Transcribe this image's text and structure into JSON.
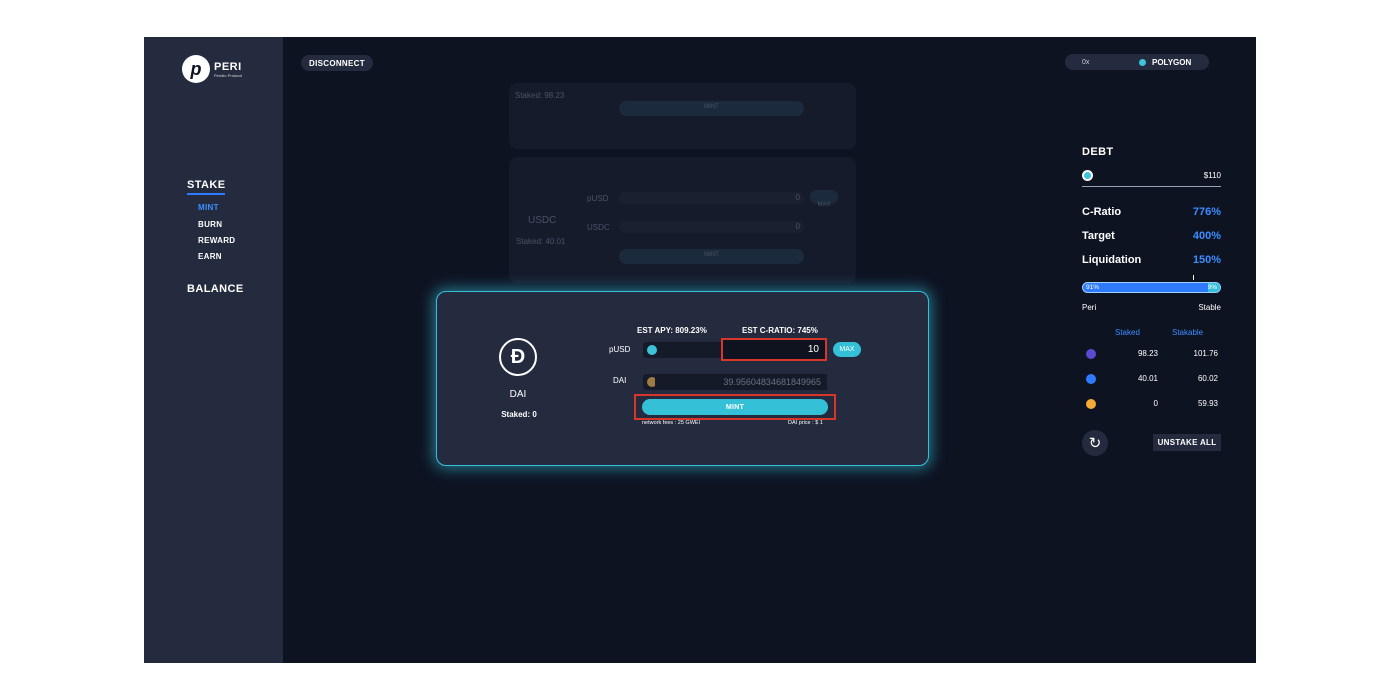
{
  "brand": {
    "name": "PERI",
    "tagline": "Peridio Protocol"
  },
  "header": {
    "disconnect": "DISCONNECT",
    "address": "0x",
    "network": "POLYGON"
  },
  "sidebar": {
    "stake": "STAKE",
    "items": [
      "MINT",
      "BURN",
      "REWARD",
      "EARN"
    ],
    "balance": "BALANCE"
  },
  "background_cards": {
    "top_staked": "Staked: 98.23",
    "top_mint": "MINT",
    "usdc_name": "USDC",
    "usdc_staked": "Staked: 40.01",
    "usdc_pusd_label": "pUSD",
    "usdc_pusd_value": "0",
    "usdc_max": "MAX",
    "usdc_usdc_label": "USDC",
    "usdc_usdc_value": "0",
    "usdc_mint": "MINT"
  },
  "modal": {
    "coin_name": "DAI",
    "staked": "Staked: 0",
    "est_apy": "EST APY: 809.23%",
    "est_cratio": "EST C-RATIO: 745%",
    "pusd_label": "pUSD",
    "pusd_amount": "10",
    "max": "MAX",
    "dai_label": "DAI",
    "dai_amount": "39.95604834681849965",
    "mint": "MINT",
    "fees": "network fees : 25 GWEI",
    "price": "DAI price : $ 1"
  },
  "debt_panel": {
    "title": "DEBT",
    "debt_value": "$110",
    "cratio_label": "C-Ratio",
    "cratio_value": "776%",
    "target_label": "Target",
    "target_value": "400%",
    "liq_label": "Liquidation",
    "liq_value": "150%",
    "peri_pct_label": "91%",
    "stable_pct_label": "9%",
    "peri_fraction": 0.91,
    "bar_left": "Peri",
    "bar_right": "Stable",
    "col_staked": "Staked",
    "col_stakable": "Stakable",
    "rows": [
      {
        "icon": "peri-token-icon",
        "staked": "98.23",
        "stakable": "101.76",
        "color": "#5a4bd1"
      },
      {
        "icon": "usdc-token-icon",
        "staked": "40.01",
        "stakable": "60.02",
        "color": "#2f7bff"
      },
      {
        "icon": "dai-token-icon",
        "staked": "0",
        "stakable": "59.93",
        "color": "#f5ac37"
      }
    ],
    "unstake_all": "UNSTAKE ALL"
  },
  "colors": {
    "accent": "#34c1d8",
    "blue": "#3b8dff",
    "highlight": "#d9362a",
    "bg": "#0e1322",
    "panel": "#252b3f"
  }
}
